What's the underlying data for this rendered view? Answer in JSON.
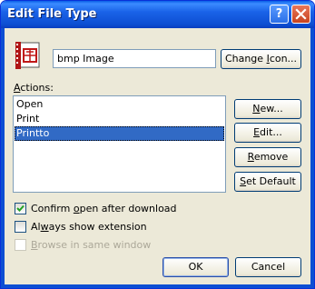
{
  "window": {
    "title": "Edit File Type",
    "help_glyph": "?"
  },
  "file_type": {
    "icon": "bmp-file-icon",
    "name": "bmp Image"
  },
  "buttons": {
    "change_icon": {
      "pre": "Change ",
      "u": "I",
      "post": "con..."
    },
    "new": {
      "pre": "",
      "u": "N",
      "post": "ew..."
    },
    "edit": {
      "pre": "",
      "u": "E",
      "post": "dit..."
    },
    "remove": {
      "pre": "",
      "u": "R",
      "post": "emove"
    },
    "set_default": {
      "pre": "",
      "u": "S",
      "post": "et Default"
    },
    "ok": "OK",
    "cancel": "Cancel"
  },
  "actions_label": {
    "pre": "",
    "u": "A",
    "post": "ctions:"
  },
  "actions": [
    "Open",
    "Print",
    "Printto"
  ],
  "selected_action": "Printto",
  "options": {
    "confirm_open": {
      "pre": "Confirm ",
      "u": "o",
      "post": "pen after download",
      "checked": true,
      "enabled": true
    },
    "always_show": {
      "pre": "Al",
      "u": "w",
      "post": "ays show extension",
      "checked": false,
      "enabled": true
    },
    "browse_same": {
      "pre": "",
      "u": "B",
      "post": "rowse in same window",
      "checked": false,
      "enabled": false
    }
  }
}
